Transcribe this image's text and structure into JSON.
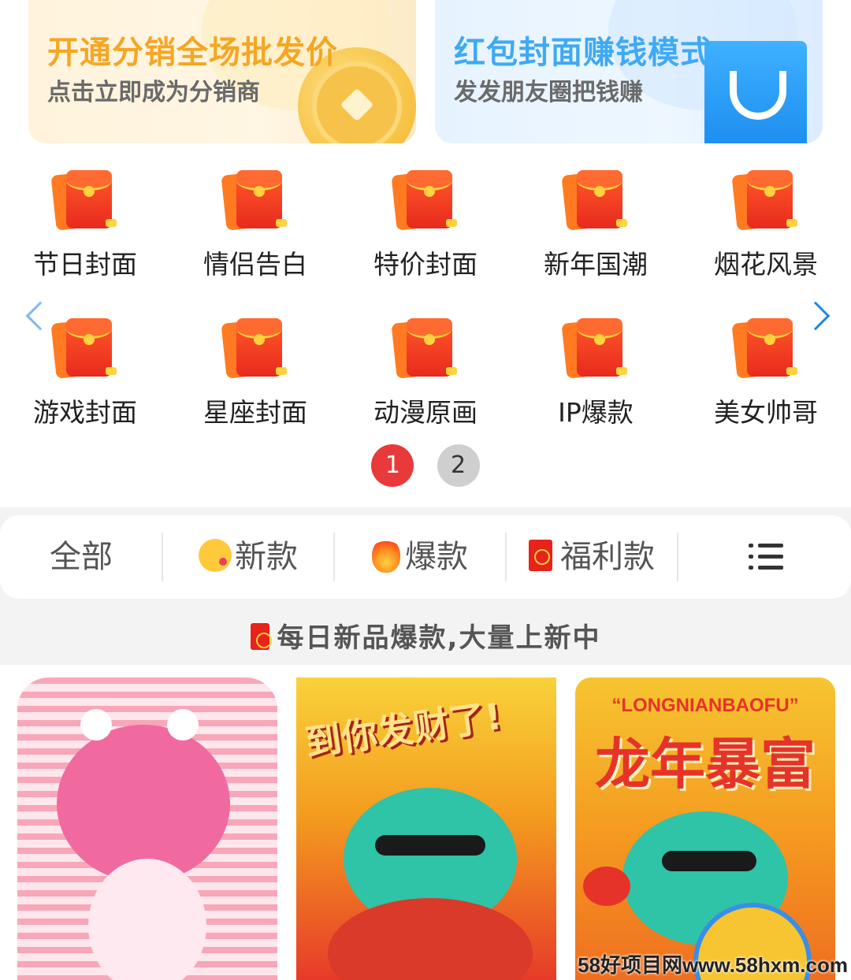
{
  "banners": {
    "left": {
      "title": "开通分销全场批发价",
      "subtitle": "点击立即成为分销商"
    },
    "right": {
      "title": "红包封面赚钱模式",
      "subtitle": "发发朋友圈把钱赚"
    }
  },
  "categories": [
    {
      "label": "节日封面"
    },
    {
      "label": "情侣告白"
    },
    {
      "label": "特价封面"
    },
    {
      "label": "新年国潮"
    },
    {
      "label": "烟花风景"
    },
    {
      "label": "游戏封面"
    },
    {
      "label": "星座封面"
    },
    {
      "label": "动漫原画"
    },
    {
      "label": "IP爆款"
    },
    {
      "label": "美女帅哥"
    }
  ],
  "pager": {
    "pages": [
      "1",
      "2"
    ],
    "active": "1"
  },
  "tabs": {
    "all": "全部",
    "new": "新款",
    "hot": "爆款",
    "welfare": "福利款"
  },
  "notice": "每日新品爆款,大量上新中",
  "products": [
    {
      "text": ""
    },
    {
      "text": "到你发财了!"
    },
    {
      "top_text": "“LONGNIANBAOFU”",
      "text": "龙年暴富"
    }
  ],
  "watermark": "58好项目网www.58hxm.com",
  "colors": {
    "accent_red": "#e83a3a",
    "banner_orange": "#f5a623",
    "banner_blue": "#3fa9f5"
  }
}
